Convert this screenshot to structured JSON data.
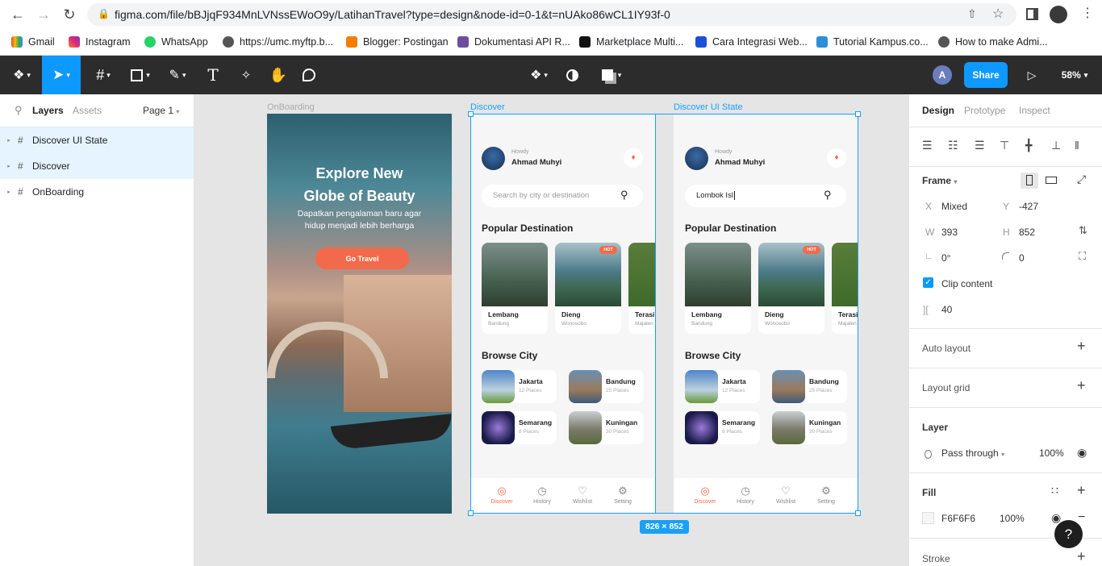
{
  "browser": {
    "url": "figma.com/file/bBJjqF934MnLVNssEWoO9y/LatihanTravel?type=design&node-id=0-1&t=nUAko86wCL1IY93f-0",
    "bookmarks": [
      "Gmail",
      "Instagram",
      "WhatsApp",
      "https://umc.myftp.b...",
      "Blogger: Postingan",
      "Dokumentasi API R...",
      "Marketplace Multi...",
      "Cara Integrasi Web...",
      "Tutorial Kampus.co...",
      "How to make Admi..."
    ]
  },
  "toolbar": {
    "avatar": "A",
    "share": "Share",
    "zoom": "58%"
  },
  "left_panel": {
    "tabs": [
      "Layers",
      "Assets"
    ],
    "page": "Page 1",
    "layers": [
      "Discover UI State",
      "Discover",
      "OnBoarding"
    ]
  },
  "canvas": {
    "frame_labels": [
      "OnBoarding",
      "Discover",
      "Discover UI State"
    ],
    "size_badge": "826 × 852",
    "onboarding": {
      "title_line1": "Explore New",
      "title_line2": "Globe of Beauty",
      "subtitle_line1": "Dapatkan pengalaman baru agar",
      "subtitle_line2": "hidup menjadi lebih berharga",
      "button": "Go Travel"
    },
    "discover": {
      "greeting": "Howdy",
      "user": "Ahmad Muhyi",
      "search_placeholder": "Search by city or destination",
      "search_value": "Lombok Isl",
      "popular_title": "Popular Destination",
      "hot_badge": "HOT",
      "destinations": [
        {
          "name": "Lembang",
          "city": "Bandung"
        },
        {
          "name": "Dieng",
          "city": "Wonosobo"
        },
        {
          "name": "Terasi",
          "city": "Majalen"
        }
      ],
      "browse_title": "Browse City",
      "cities": [
        {
          "name": "Jakarta",
          "places": "12 Places"
        },
        {
          "name": "Bandung",
          "places": "25 Places"
        },
        {
          "name": "Semarang",
          "places": "8 Places"
        },
        {
          "name": "Kuningan",
          "places": "30 Places"
        }
      ],
      "nav": [
        "Discover",
        "History",
        "Wishlist",
        "Setting"
      ]
    }
  },
  "right_panel": {
    "tabs": [
      "Design",
      "Prototype",
      "Inspect"
    ],
    "frame_title": "Frame",
    "x_label": "X",
    "x_value": "Mixed",
    "y_label": "Y",
    "y_value": "-427",
    "w_label": "W",
    "w_value": "393",
    "h_label": "H",
    "h_value": "852",
    "rotation": "0°",
    "radius": "0",
    "clip_content": "Clip content",
    "spacing": "40",
    "auto_layout": "Auto layout",
    "layout_grid": "Layout grid",
    "layer_title": "Layer",
    "blend_mode": "Pass through",
    "layer_opacity": "100%",
    "fill_title": "Fill",
    "fill_hex": "F6F6F6",
    "fill_opacity": "100%",
    "stroke_title": "Stroke",
    "help": "?"
  },
  "colors": {
    "accent": "#0d99ff",
    "toolbar": "#2c2c2c",
    "selection": "#18a0fb",
    "orange": "#f26a4b",
    "fill": "#f6f6f6"
  }
}
